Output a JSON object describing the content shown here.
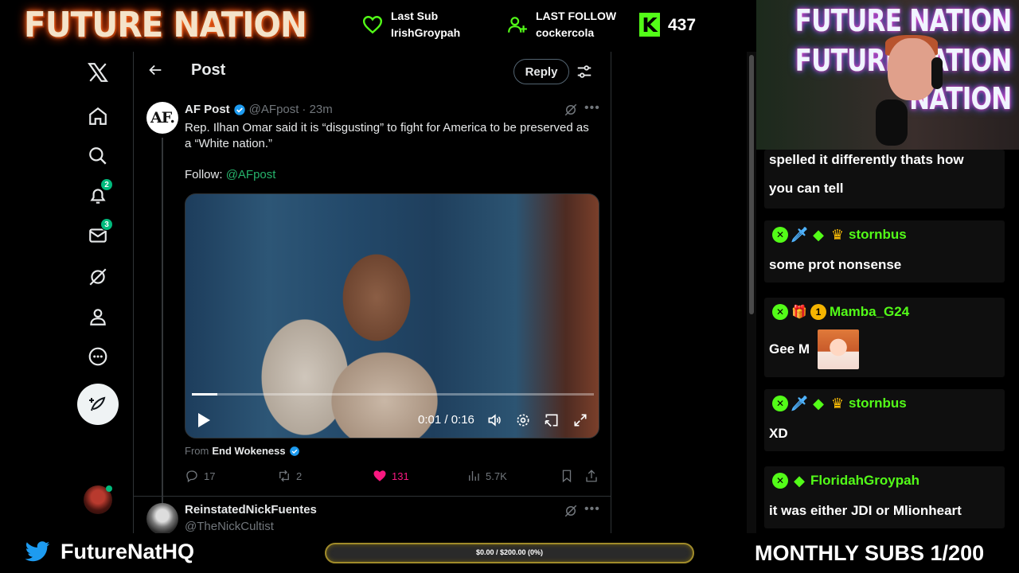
{
  "overlay": {
    "brand": "FUTURE NATION",
    "last_sub_label": "Last Sub",
    "last_sub_name": "IrishGroypah",
    "last_follow_label": "LAST FOLLOW",
    "last_follow_name": "cockercola",
    "kick_count": "437",
    "webcam_sign": [
      "FUTURE NATION",
      "FUTURE NATION",
      "NATION"
    ],
    "twitter_handle": "FutureNatHQ",
    "goal_text": "$0.00 / $200.00 (0%)",
    "goal_progress": 0,
    "monthly_subs": "MONTHLY SUBS 1/200",
    "accent_kick": "#53fc18",
    "accent_twitter": "#1d9bf0"
  },
  "x_nav": {
    "items": [
      {
        "icon": "x-logo-icon"
      },
      {
        "icon": "home-icon"
      },
      {
        "icon": "search-icon"
      },
      {
        "icon": "notifications-icon",
        "badge": "2"
      },
      {
        "icon": "messages-icon",
        "badge": "3"
      },
      {
        "icon": "grok-icon"
      },
      {
        "icon": "profile-icon"
      },
      {
        "icon": "more-icon"
      },
      {
        "icon": "post-compose-icon"
      }
    ]
  },
  "post_view": {
    "title": "Post",
    "reply_label": "Reply",
    "tweet": {
      "author_name": "AF Post",
      "author_handle": "@AFpost",
      "time": "· 23m",
      "avatar_text": "AF.",
      "text": "Rep. Ilhan Omar said it is “disgusting” to fight for America to be preserved as a “White nation.”",
      "follow_prefix": "Follow: ",
      "follow_handle": "@AFpost",
      "video": {
        "time": "0:01 / 0:16",
        "progress": 0.0625
      },
      "from_prefix": "From",
      "from_name": "End Wokeness",
      "replies": "17",
      "reposts": "2",
      "likes": "131",
      "views": "5.7K",
      "like_color": "#f91880"
    },
    "next_tweet": {
      "author_name": "ReinstatedNickFuentes",
      "author_handle": "@TheNickCultist"
    }
  },
  "chat": {
    "messages": [
      {
        "text_lines": [
          "spelled it differently thats how",
          "you can tell"
        ]
      },
      {
        "user": "stornbus",
        "text": "some prot nonsense"
      },
      {
        "user": "Mamba_G24",
        "text": "Gee M"
      },
      {
        "user": "stornbus",
        "text": "XD"
      },
      {
        "user": "FloridahGroypah",
        "text": "it was either JDI or Mlionheart"
      }
    ]
  }
}
